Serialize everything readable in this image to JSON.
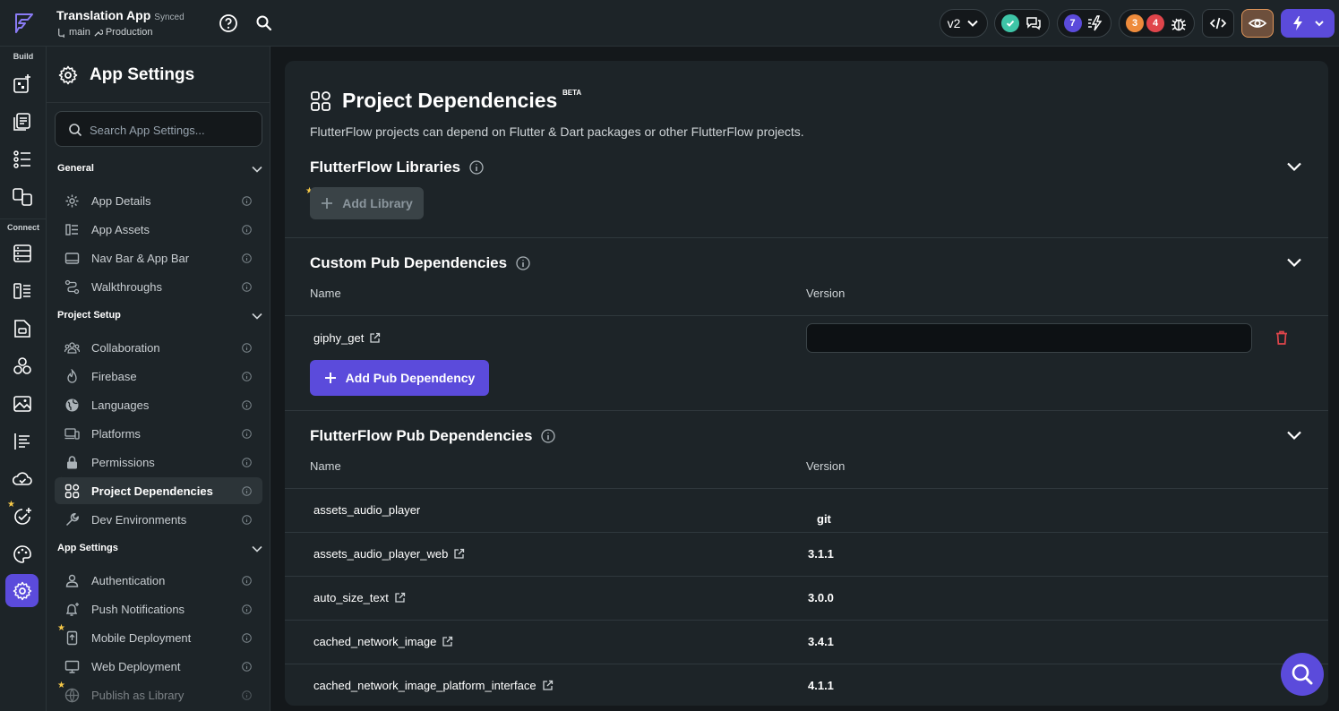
{
  "header": {
    "app_name": "Translation App",
    "sync_status": "Synced",
    "branch": "main",
    "environment": "Production",
    "version_label": "v2",
    "notification_count": "7",
    "warning_count": "3",
    "error_count": "4"
  },
  "rail": {
    "build_label": "Build",
    "connect_label": "Connect"
  },
  "settings": {
    "title": "App Settings",
    "search_placeholder": "Search App Settings...",
    "sections": {
      "general": "General",
      "project_setup": "Project Setup",
      "app_settings": "App Settings"
    },
    "items": {
      "app_details": "App Details",
      "app_assets": "App Assets",
      "nav_bar": "Nav Bar & App Bar",
      "walkthroughs": "Walkthroughs",
      "collaboration": "Collaboration",
      "firebase": "Firebase",
      "languages": "Languages",
      "platforms": "Platforms",
      "permissions": "Permissions",
      "project_dependencies": "Project Dependencies",
      "dev_environments": "Dev Environments",
      "authentication": "Authentication",
      "push_notifications": "Push Notifications",
      "mobile_deployment": "Mobile Deployment",
      "web_deployment": "Web Deployment",
      "publish_library": "Publish as Library"
    }
  },
  "main": {
    "title": "Project Dependencies",
    "beta": "BETA",
    "description": "FlutterFlow projects can depend on Flutter & Dart packages or other FlutterFlow projects.",
    "libraries": {
      "title": "FlutterFlow Libraries",
      "add_label": "Add Library"
    },
    "custom_pub": {
      "title": "Custom Pub Dependencies",
      "name_header": "Name",
      "version_header": "Version",
      "package": "giphy_get",
      "version_value": "",
      "add_label": "Add Pub Dependency"
    },
    "ff_pub": {
      "title": "FlutterFlow Pub Dependencies",
      "name_header": "Name",
      "version_header": "Version",
      "rows": [
        {
          "name": "assets_audio_player",
          "version": "git"
        },
        {
          "name": "assets_audio_player_web",
          "version": "3.1.1"
        },
        {
          "name": "auto_size_text",
          "version": "3.0.0"
        },
        {
          "name": "cached_network_image",
          "version": "3.4.1"
        },
        {
          "name": "cached_network_image_platform_interface",
          "version": "4.1.1"
        }
      ]
    }
  }
}
